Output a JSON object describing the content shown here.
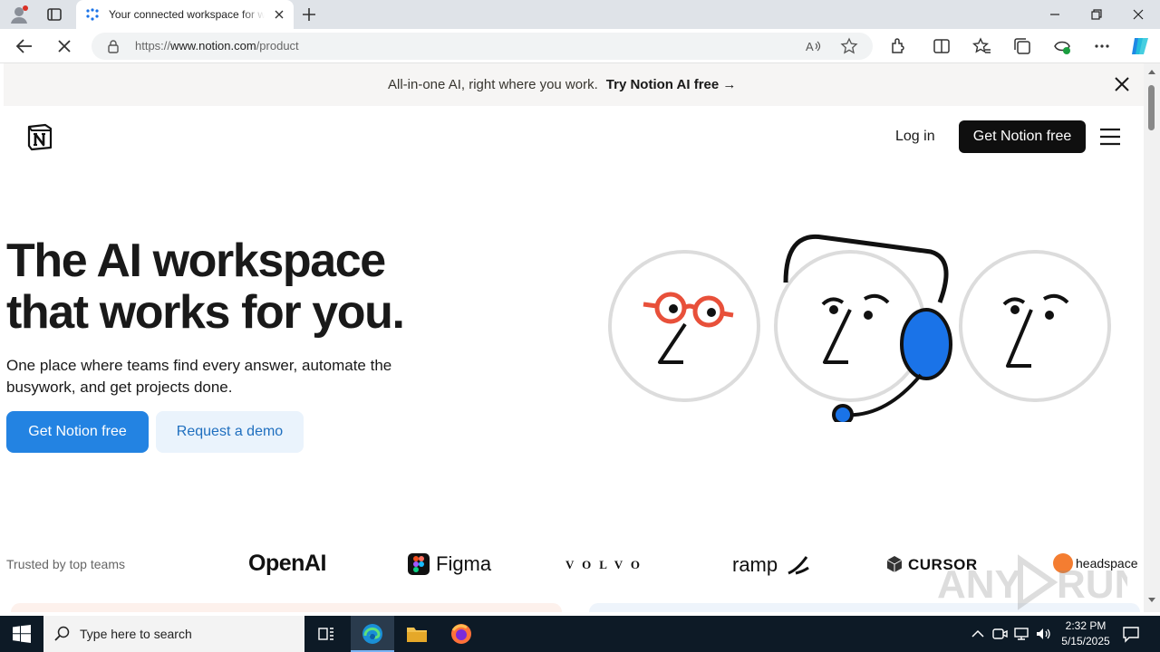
{
  "browser": {
    "tab_title": "Your connected workspace for wiki, docs & projects",
    "url_prefix": "https://",
    "url_host": "www.notion.com",
    "url_path": "/product"
  },
  "banner": {
    "text": "All-in-one AI, right where you work.",
    "link": "Try Notion AI free →"
  },
  "nav": {
    "login": "Log in",
    "cta": "Get Notion free"
  },
  "hero": {
    "title_line1": "The AI workspace",
    "title_line2": "that works for you.",
    "subtitle": "One place where teams find every answer, automate the busywork, and get projects done.",
    "primary_button": "Get Notion free",
    "secondary_button": "Request a demo"
  },
  "trusted": {
    "label": "Trusted by top teams",
    "logos": [
      "OpenAI",
      "Figma",
      "VOLVO",
      "ramp",
      "CURSOR",
      "headspace"
    ]
  },
  "taskbar": {
    "search_placeholder": "Type here to search",
    "time": "2:32 PM",
    "date": "5/15/2025"
  },
  "colors": {
    "primary_blue": "#2383e2",
    "dark_button": "#0f0f0f",
    "banner_bg": "#f6f5f4",
    "taskbar_bg": "#0d1a26"
  }
}
